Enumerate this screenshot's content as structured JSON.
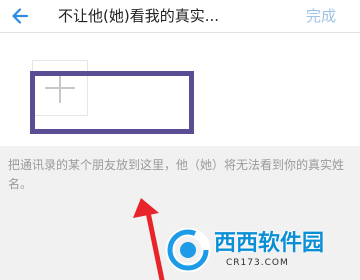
{
  "header": {
    "back_icon": "arrow-left-icon",
    "title": "不让他(她)看我的真实...",
    "done_label": "完成"
  },
  "member_area": {
    "add_icon": "plus-icon"
  },
  "hint": {
    "text": "把通讯录的某个朋友放到这里，他（她）将无法看到你的真实姓名。"
  },
  "watermark": {
    "name": "西西软件园",
    "url": "CR173.COM"
  },
  "colors": {
    "accent_done": "#9ec3e6",
    "back_arrow": "#2d8de0",
    "highlight_border": "#5a4d94",
    "annotation_arrow": "#e8242a"
  }
}
